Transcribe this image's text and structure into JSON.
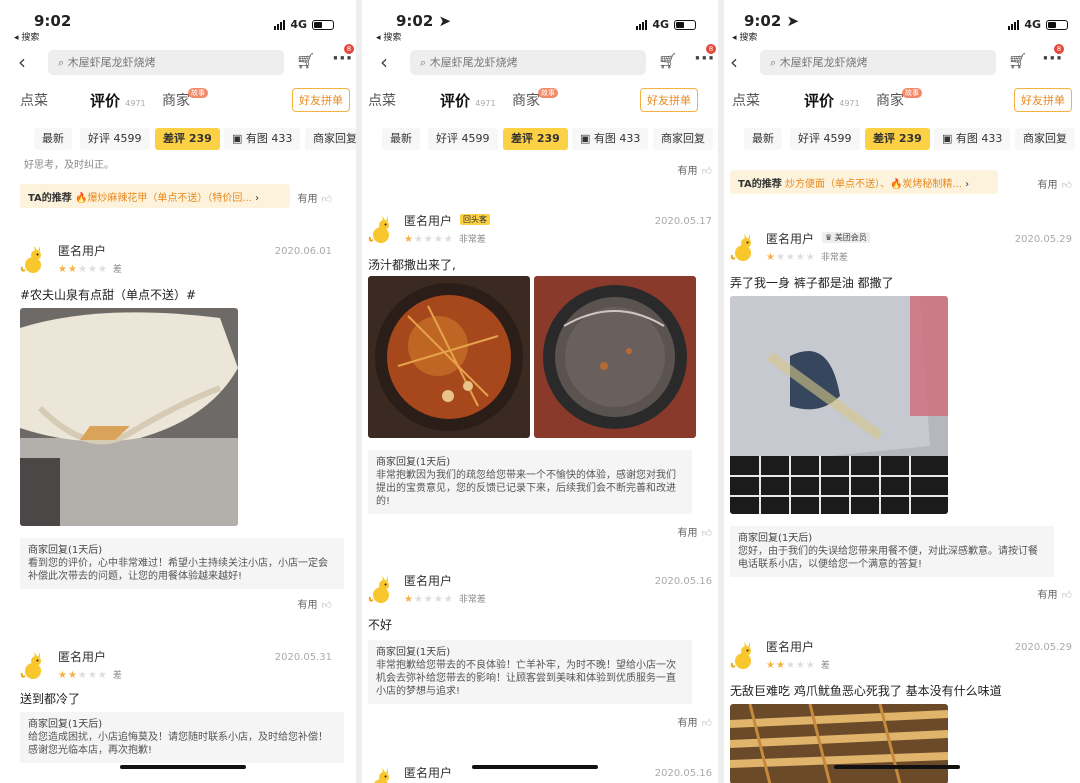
{
  "status": {
    "time": "9:02",
    "back_label": "◂ 搜索",
    "network": "4G"
  },
  "nav": {
    "search_placeholder": "木屋虾尾龙虾烧烤",
    "cart_badge": "8"
  },
  "tabs": {
    "menu": "点菜",
    "reviews": "评价",
    "reviews_count": "4971",
    "merchant": "商家",
    "merchant_badge": "故事",
    "group": "好友拼单"
  },
  "filters": [
    "最新",
    "好评 4599",
    "差评 239",
    "有图 433",
    "商家回复"
  ],
  "colors": {
    "accent": "#fcd145",
    "orange": "#e8891e",
    "star": "#f6b142"
  },
  "screens": [
    {
      "partial_text": "好思考，及时纠正。",
      "reco": {
        "label": "TA的推荐",
        "items": "🔥爆炒麻辣花甲（单点不送）（特价回..."
      },
      "useful_label": "有用",
      "reviews": [
        {
          "user": "匿名用户",
          "badge": "",
          "date": "2020.06.01",
          "stars": 2,
          "rating_label": "差",
          "text": "#农夫山泉有点甜（单点不送）#",
          "reply_head": "商家回复(1天后)",
          "reply": "看到您的评价，心中非常难过！希望小主持续关注小店，小店一定会补偿此次带去的问题，让您的用餐体验越来越好!"
        },
        {
          "user": "匿名用户",
          "badge": "",
          "date": "2020.05.31",
          "stars": 2,
          "rating_label": "差",
          "text": "送到都冷了",
          "reply_head": "商家回复(1天后)",
          "reply": "给您造成困扰，小店追悔莫及！请您随时联系小店，及时给您补偿！感谢您光临本店，再次抱歉!"
        }
      ]
    },
    {
      "useful_label": "有用",
      "reviews": [
        {
          "user": "匿名用户",
          "badge": "回头客",
          "date": "2020.05.17",
          "stars": 1,
          "rating_label": "非常差",
          "text": "汤汁都撒出来了,",
          "reply_head": "商家回复(1天后)",
          "reply": "非常抱歉因为我们的疏忽给您带来一个不愉快的体验，感谢您对我们提出的宝贵意见，您的反馈已记录下来，后续我们会不断完善和改进的!"
        },
        {
          "user": "匿名用户",
          "badge": "",
          "date": "2020.05.16",
          "stars": 1,
          "rating_label": "非常差",
          "text": "不好",
          "reply_head": "商家回复(1天后)",
          "reply": "非常抱歉给您带去的不良体验！亡羊补牢，为时不晚！望给小店一次机会去弥补给您带去的影响！让顾客尝到美味和体验到优质服务一直小店的梦想与追求!"
        },
        {
          "user": "匿名用户",
          "badge": "",
          "date": "2020.05.16",
          "stars": 1,
          "rating_label": "",
          "text": "",
          "reply_head": "",
          "reply": ""
        }
      ]
    },
    {
      "reco": {
        "label": "TA的推荐",
        "items": "炒方便面（单点不送）、🔥炭烤秘制精... "
      },
      "useful_label": "有用",
      "reviews": [
        {
          "user": "匿名用户",
          "badge": "美团会员",
          "date": "2020.05.29",
          "stars": 1,
          "rating_label": "非常差",
          "text": "弄了我一身 裤子都是油 都撒了",
          "reply_head": "商家回复(1天后)",
          "reply": "您好，由于我们的失误给您带来用餐不便，对此深感歉意。请按订餐电话联系小店，以便给您一个满意的答复!"
        },
        {
          "user": "匿名用户",
          "badge": "",
          "date": "2020.05.29",
          "stars": 2,
          "rating_label": "差",
          "text": "无敌巨难吃 鸡爪鱿鱼恶心死我了 基本没有什么味道",
          "reply_head": "",
          "reply": ""
        }
      ]
    }
  ]
}
